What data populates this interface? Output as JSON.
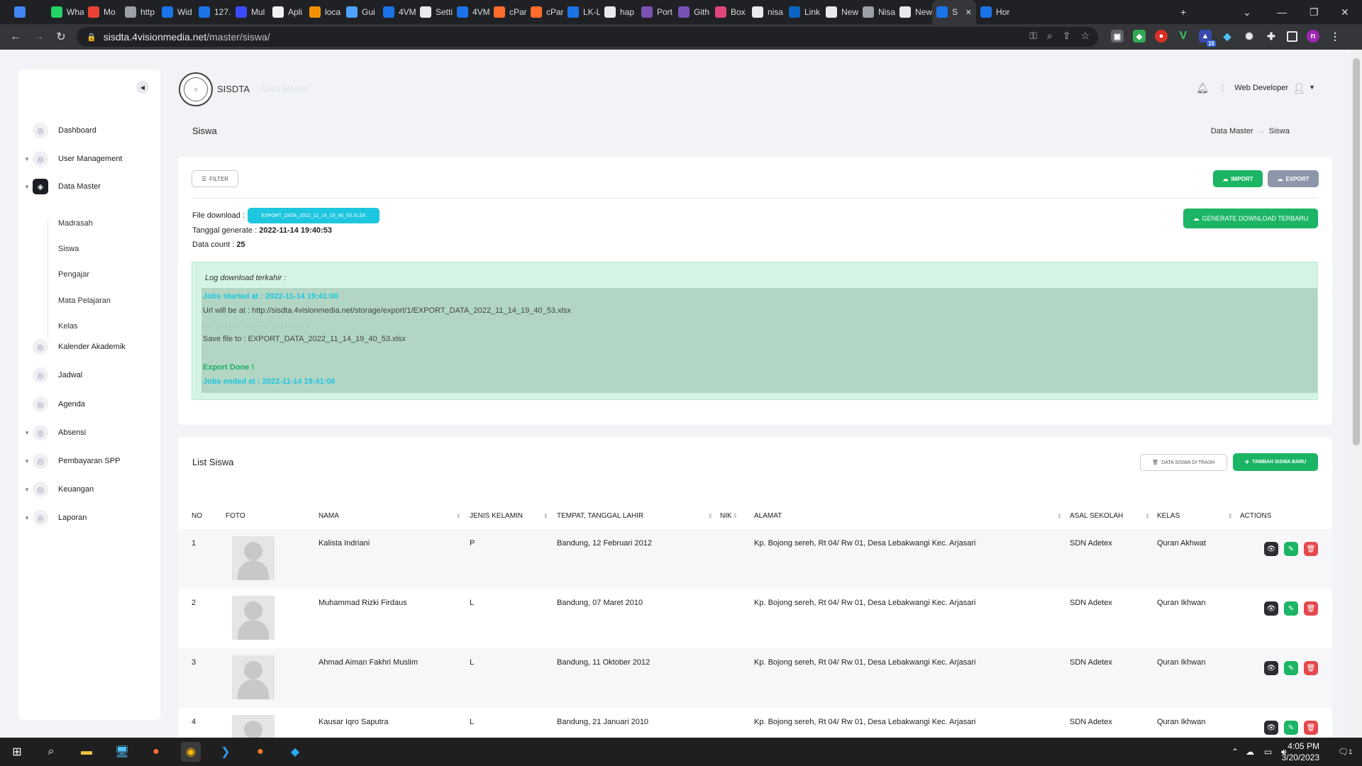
{
  "browser": {
    "tabs": [
      {
        "label": "",
        "icon": "browser-gem-icon",
        "color": "#4285f4"
      },
      {
        "label": "Wha",
        "icon": "whatsapp-icon",
        "color": "#25d366"
      },
      {
        "label": "Mo",
        "icon": "circle-dots-icon",
        "color": "#ea4335"
      },
      {
        "label": "http",
        "icon": "globe-icon",
        "color": "#9aa0a6"
      },
      {
        "label": "Wid",
        "icon": "edge-icon",
        "color": "#1a73e8"
      },
      {
        "label": "127.",
        "icon": "edge-icon",
        "color": "#1a73e8"
      },
      {
        "label": "Mul",
        "icon": "f-logo-icon",
        "color": "#3b4bff"
      },
      {
        "label": "Apli",
        "icon": "cloud-icon",
        "color": "#f2f2f2"
      },
      {
        "label": "loca",
        "icon": "triangle-logo-icon",
        "color": "#f29100"
      },
      {
        "label": "Gui",
        "icon": "puzzle-icon",
        "color": "#4fa3ff"
      },
      {
        "label": "4VM",
        "icon": "edge-icon",
        "color": "#1a73e8"
      },
      {
        "label": "Setti",
        "icon": "gear-icon",
        "color": "#e8eaed"
      },
      {
        "label": "4VM",
        "icon": "edge-icon",
        "color": "#1a73e8"
      },
      {
        "label": "cPar",
        "icon": "cpanel-icon",
        "color": "#ff6c2c"
      },
      {
        "label": "cPar",
        "icon": "cpanel-icon",
        "color": "#ff6c2c"
      },
      {
        "label": "LK-L",
        "icon": "edge-icon",
        "color": "#1a73e8"
      },
      {
        "label": "hap",
        "icon": "google-icon",
        "color": "#e8eaed"
      },
      {
        "label": "Port",
        "icon": "b-logo-icon",
        "color": "#7952b3"
      },
      {
        "label": "Gith",
        "icon": "b-logo-icon",
        "color": "#7952b3"
      },
      {
        "label": "Box",
        "icon": "box-logo-icon",
        "color": "#e0457b"
      },
      {
        "label": "nisa",
        "icon": "github-icon",
        "color": "#e8eaed"
      },
      {
        "label": "Link",
        "icon": "linkedin-icon",
        "color": "#0a66c2"
      },
      {
        "label": "New",
        "icon": "chrome-icon",
        "color": "#e8eaed"
      },
      {
        "label": "Nisa",
        "icon": "globe-icon",
        "color": "#9aa0a6"
      },
      {
        "label": "New",
        "icon": "chrome-icon",
        "color": "#e8eaed"
      },
      {
        "label": "S",
        "icon": "edge-icon",
        "color": "#1a73e8",
        "active": true
      },
      {
        "label": "Hor",
        "icon": "edge-icon",
        "color": "#1a73e8"
      }
    ],
    "url_host": "sisdta.4visionmedia.net",
    "url_path": "/master/siswa/"
  },
  "sidebar": {
    "items": [
      {
        "label": "Dashboard",
        "icon": "dashboard-icon"
      },
      {
        "label": "User Management",
        "icon": "user-icon"
      },
      {
        "label": "Data Master",
        "icon": "layers-icon"
      },
      {
        "label": "Kalender Akademik",
        "icon": "calendar-icon"
      },
      {
        "label": "Jadwal",
        "icon": "schedule-icon"
      },
      {
        "label": "Agenda",
        "icon": "agenda-icon"
      },
      {
        "label": "Absensi",
        "icon": "attendance-icon"
      },
      {
        "label": "Pembayaran SPP",
        "icon": "payment-icon"
      },
      {
        "label": "Keuangan",
        "icon": "finance-icon"
      },
      {
        "label": "Laporan",
        "icon": "report-icon"
      }
    ],
    "sub_items": [
      "Madrasah",
      "Siswa",
      "Pengajar",
      "Mata Pelajaran",
      "Kelas"
    ]
  },
  "header": {
    "app_name": "SISDTA",
    "faint_crumb": "Data Master",
    "user_name": "Web Developer",
    "page_title": "Siswa",
    "breadcrumb": [
      "Data Master",
      "Siswa"
    ]
  },
  "export_card": {
    "filter_label": "FILTER",
    "import_label": "IMPORT",
    "export_label": "EXPORT",
    "generate_label": "GENERATE DOWNLOAD TERBARU",
    "file_download_label": "File download :",
    "file_name": "EXPORT_DATA_2022_11_14_19_40_53.XLSX",
    "tanggal_label": "Tanggal generate :",
    "tanggal_value": "2022-11-14 19:40:53",
    "count_label": "Data count :",
    "count_value": "25",
    "log_title": "Log download terkahir :",
    "log": {
      "jobs_started": "Jobs started at : 2022-11-14 19:41:00",
      "url_line": "Url will be at : http://sisdta.4visionmedia.net/storage/export/1/EXPORT_DATA_2022_11_14_19_40_53.xlsx",
      "dots": ". . . . . . . . . . . . . . . . . . . . . . . . .",
      "save_line": "Save file to : EXPORT_DATA_2022_11_14_19_40_53.xlsx",
      "done": "Export Done !",
      "jobs_ended": "Jobs ended at : 2022-11-14 19:41:06"
    }
  },
  "list_card": {
    "title": "List Siswa",
    "trash_label": "DATA SISWA DI TRASH",
    "add_label": "TAMBAH SISWA BARU",
    "columns": [
      "NO",
      "FOTO",
      "NAMA",
      "JENIS KELAMIN",
      "TEMPAT, TANGGAL LAHIR",
      "NIK",
      "ALAMAT",
      "ASAL SEKOLAH",
      "KELAS",
      "ACTIONS"
    ],
    "rows": [
      {
        "no": "1",
        "nama": "Kalista Indriani",
        "jk": "P",
        "ttl": "Bandung, 12 Februari 2012",
        "nik": "",
        "alamat": "Kp. Bojong sereh, Rt 04/ Rw 01, Desa Lebakwangi Kec. Arjasari",
        "sekolah": "SDN Adetex",
        "kelas": "Quran Akhwat"
      },
      {
        "no": "2",
        "nama": "Muhammad Rizki Firdaus",
        "jk": "L",
        "ttl": "Bandung, 07 Maret 2010",
        "nik": "",
        "alamat": "Kp. Bojong sereh, Rt 04/ Rw 01, Desa Lebakwangi Kec. Arjasari",
        "sekolah": "SDN Adetex",
        "kelas": "Quran Ikhwan"
      },
      {
        "no": "3",
        "nama": "Ahmad Aiman Fakhri Muslim",
        "jk": "L",
        "ttl": "Bandung, 11 Oktober 2012",
        "nik": "",
        "alamat": "Kp. Bojong sereh, Rt 04/ Rw 01, Desa Lebakwangi Kec. Arjasari",
        "sekolah": "SDN Adetex",
        "kelas": "Quran Ikhwan"
      },
      {
        "no": "4",
        "nama": "Kausar Iqro Saputra",
        "jk": "L",
        "ttl": "Bandung, 21 Januari 2010",
        "nik": "",
        "alamat": "Kp. Bojong sereh, Rt 04/ Rw 01, Desa Lebakwangi Kec. Arjasari",
        "sekolah": "SDN Adetex",
        "kelas": "Quran Ikhwan"
      }
    ]
  },
  "taskbar": {
    "time": "4:05 PM",
    "date": "3/20/2023",
    "notification_count": "1",
    "extension_badge": "15",
    "profile_initial": "n"
  },
  "colors": {
    "accent_green": "#1bb565",
    "accent_teal": "#1ec6df",
    "danger": "#e5494d"
  }
}
